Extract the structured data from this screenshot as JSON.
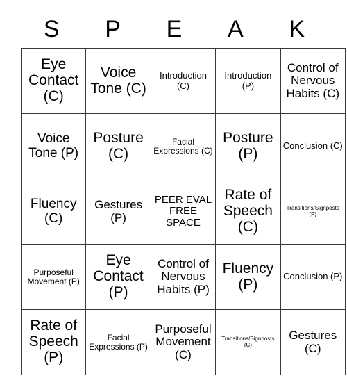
{
  "card": {
    "title_letters": [
      "S",
      "P",
      "E",
      "A",
      "K"
    ],
    "rows": [
      [
        {
          "text": "Eye Contact (C)",
          "size": "fs-xl"
        },
        {
          "text": "Voice Tone (C)",
          "size": "fs-xl"
        },
        {
          "text": "Introduction (C)",
          "size": "fs-sm"
        },
        {
          "text": "Introduction (P)",
          "size": "fs-sm"
        },
        {
          "text": "Control of Nervous Habits (C)",
          "size": "fs-md"
        }
      ],
      [
        {
          "text": "Voice Tone (P)",
          "size": "fs-lg"
        },
        {
          "text": "Posture (C)",
          "size": "fs-xl"
        },
        {
          "text": "Facial Expressions (C)",
          "size": "fs-xs"
        },
        {
          "text": "Posture (P)",
          "size": "fs-xl"
        },
        {
          "text": "Conclusion (C)",
          "size": "fs-sm"
        }
      ],
      [
        {
          "text": "Fluency (C)",
          "size": "fs-lg"
        },
        {
          "text": "Gestures (P)",
          "size": "fs-md"
        },
        {
          "text": "PEER EVAL FREE SPACE",
          "size": "free-space"
        },
        {
          "text": "Rate of Speech (C)",
          "size": "fs-xl"
        },
        {
          "text": "Transitions/Signposts (P)",
          "size": "fs-tiny"
        }
      ],
      [
        {
          "text": "Purposeful Movement (P)",
          "size": "fs-xs"
        },
        {
          "text": "Eye Contact (P)",
          "size": "fs-xl"
        },
        {
          "text": "Control of Nervous Habits (P)",
          "size": "fs-md"
        },
        {
          "text": "Fluency (P)",
          "size": "fs-xl"
        },
        {
          "text": "Conclusion (P)",
          "size": "fs-sm"
        }
      ],
      [
        {
          "text": "Rate of Speech (P)",
          "size": "fs-xl"
        },
        {
          "text": "Facial Expressions (P)",
          "size": "fs-xs"
        },
        {
          "text": "Purposeful Movement (C)",
          "size": "fs-md"
        },
        {
          "text": "Transitions/Signposts (C)",
          "size": "fs-tiny"
        },
        {
          "text": "Gestures (C)",
          "size": "fs-md"
        }
      ]
    ]
  },
  "colors": {
    "border": "#3a3a3a",
    "text": "#000000",
    "background": "#ffffff"
  }
}
